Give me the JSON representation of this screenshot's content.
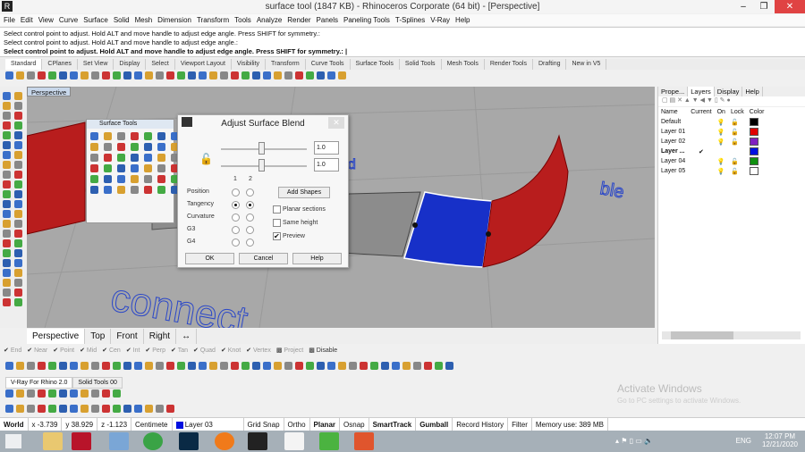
{
  "window": {
    "title": "surface tool (1847 KB) - Rhinoceros Corporate (64 bit) - [Perspective]",
    "minimize": "–",
    "maximize": "❐",
    "close": "✕"
  },
  "menu": [
    "File",
    "Edit",
    "View",
    "Curve",
    "Surface",
    "Solid",
    "Mesh",
    "Dimension",
    "Transform",
    "Tools",
    "Analyze",
    "Render",
    "Panels",
    "Paneling Tools",
    "T-Splines",
    "V-Ray",
    "Help"
  ],
  "command_history": [
    "Select control point to adjust. Hold ALT and move handle to adjust edge angle. Press SHIFT for symmetry.:",
    "Select control point to adjust. Hold ALT and move handle to adjust edge angle.:"
  ],
  "command_prompt": "Select control point to adjust. Hold ALT and move handle to adjust edge angle. Press SHIFT for symmetry.:",
  "toolbar_tabs": [
    "Standard",
    "CPlanes",
    "Set View",
    "Display",
    "Select",
    "Viewport Layout",
    "Visibility",
    "Transform",
    "Curve Tools",
    "Surface Tools",
    "Solid Tools",
    "Mesh Tools",
    "Render Tools",
    "Drafting",
    "New in V5"
  ],
  "viewport": {
    "label": "Perspective",
    "text_connect": "connect",
    "text_blend": "ble",
    "text_blend2": "nd"
  },
  "surface_tools_panel": {
    "title": "Surface Tools"
  },
  "dialog": {
    "title": "Adjust Surface Blend",
    "value1": "1.0",
    "value2": "1.0",
    "col1": "1",
    "col2": "2",
    "rows": [
      {
        "label": "Position",
        "r1": false,
        "r2": false
      },
      {
        "label": "Tangency",
        "r1": true,
        "r2": true
      },
      {
        "label": "Curvature",
        "r1": false,
        "r2": false
      },
      {
        "label": "G3",
        "r1": false,
        "r2": false
      },
      {
        "label": "G4",
        "r1": false,
        "r2": false
      }
    ],
    "add_shapes": "Add Shapes",
    "planar_sections": "Planar sections",
    "same_height": "Same height",
    "preview": "Preview",
    "preview_checked": true,
    "ok": "OK",
    "cancel": "Cancel",
    "help": "Help"
  },
  "right_panel": {
    "tabs": [
      "Prope...",
      "Layers",
      "Display",
      "Help"
    ],
    "columns": [
      "Name",
      "Current",
      "On",
      "Lock",
      "Color"
    ],
    "layers": [
      {
        "name": "Default",
        "current": "",
        "color": "#000000"
      },
      {
        "name": "Layer 01",
        "current": "",
        "color": "#e00000"
      },
      {
        "name": "Layer 02",
        "current": "",
        "color": "#8020c0"
      },
      {
        "name": "Layer ...",
        "current": "✔",
        "color": "#0010e0"
      },
      {
        "name": "Layer 04",
        "current": "",
        "color": "#109010"
      },
      {
        "name": "Layer 05",
        "current": "",
        "color": "#ffffff"
      }
    ]
  },
  "viewport_tabs": [
    "Perspective",
    "Top",
    "Front",
    "Right",
    "↔"
  ],
  "osnaps": [
    "End",
    "Near",
    "Point",
    "Mid",
    "Cen",
    "Int",
    "Perp",
    "Tan",
    "Quad",
    "Knot",
    "Vertex",
    "Project",
    "Disable"
  ],
  "lower_tabs": [
    "V-Ray For Rhino 2.0",
    "Solid Tools 00"
  ],
  "status": {
    "cplane": "World",
    "x": "x -3.739",
    "y": "y 38.929",
    "z": "z -1.123",
    "units": "Centimete",
    "layer": "Layer 03",
    "layer_color": "#0010e0",
    "items": [
      "Grid Snap",
      "Ortho",
      "Planar",
      "Osnap",
      "SmartTrack",
      "Gumball",
      "Record History",
      "Filter"
    ],
    "memory": "Memory use: 389 MB"
  },
  "watermark": {
    "title": "Activate Windows",
    "subtitle": "Go to PC settings to activate Windows."
  },
  "taskbar": {
    "lang": "ENG",
    "time": "12:07 PM",
    "date": "12/21/2020"
  }
}
